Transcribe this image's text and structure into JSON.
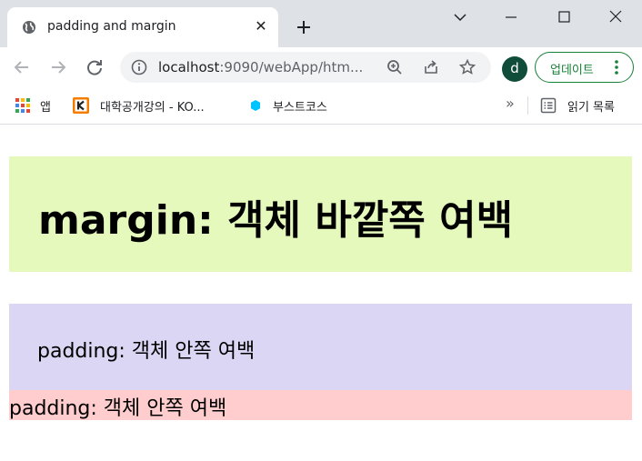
{
  "tab": {
    "title": "padding and margin",
    "close_glyph": "✕"
  },
  "toolbar": {
    "url_host": "localhost",
    "url_rest": ":9090/webApp/htm...",
    "profile_initial": "d",
    "update_label": "업데이트"
  },
  "bookmarks": {
    "items": [
      {
        "label": "앱",
        "icon": "apps-grid-icon"
      },
      {
        "label": "대학공개강의 - KO...",
        "icon": "kocw-icon"
      },
      {
        "label": "부스트코스",
        "icon": "boostcourse-icon"
      }
    ],
    "more_glyph": "»",
    "reading_list_label": "읽기 목록"
  },
  "page": {
    "margin_heading": "margin: 객체 바깥쪽 여백",
    "padding_text": "padding: 객체 안쪽 여백",
    "padding_text_2": "padding: 객체 안쪽 여백"
  },
  "colors": {
    "margin_box_bg": "#e6f9bd",
    "padding_box_bg": "#dad6f3",
    "pink_box_bg": "#ffcdcd",
    "update_accent": "#188038",
    "avatar_bg": "#0f4c3a"
  }
}
